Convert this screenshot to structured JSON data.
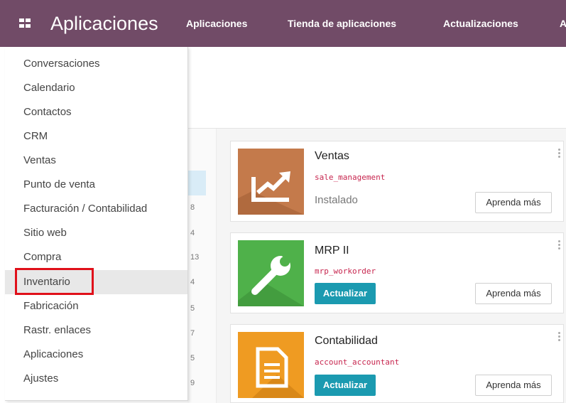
{
  "navbar": {
    "app_title": "Aplicaciones",
    "menu": [
      "Aplicaciones",
      "Tienda de aplicaciones",
      "Actualizaciones",
      "A"
    ],
    "color": "#714B67"
  },
  "apps_menu": {
    "items": [
      {
        "label": "Conversaciones"
      },
      {
        "label": "Calendario"
      },
      {
        "label": "Contactos"
      },
      {
        "label": "CRM"
      },
      {
        "label": "Ventas"
      },
      {
        "label": "Punto de venta"
      },
      {
        "label": "Facturación / Contabilidad"
      },
      {
        "label": "Sitio web"
      },
      {
        "label": "Compra"
      },
      {
        "label": "Inventario"
      },
      {
        "label": "Fabricación"
      },
      {
        "label": "Rastr. enlaces"
      },
      {
        "label": "Aplicaciones"
      },
      {
        "label": "Ajustes"
      }
    ],
    "highlighted_item": "Inventario"
  },
  "category_counts": [
    "8",
    "4",
    "13",
    "4",
    "5",
    "7",
    "5",
    "9"
  ],
  "apps": [
    {
      "name": "Ventas",
      "technical_name": "sale_management",
      "status": "Instalado",
      "learn_label": "Aprenda más",
      "icon": "chart-trend-icon",
      "icon_color": "#C47A4B"
    },
    {
      "name": "MRP II",
      "technical_name": "mrp_workorder",
      "action_label": "Actualizar",
      "learn_label": "Aprenda más",
      "icon": "wrench-icon",
      "icon_color": "#4FB14A"
    },
    {
      "name": "Contabilidad",
      "technical_name": "account_accountant",
      "action_label": "Actualizar",
      "learn_label": "Aprenda más",
      "icon": "document-icon",
      "icon_color": "#EF9B22"
    }
  ]
}
